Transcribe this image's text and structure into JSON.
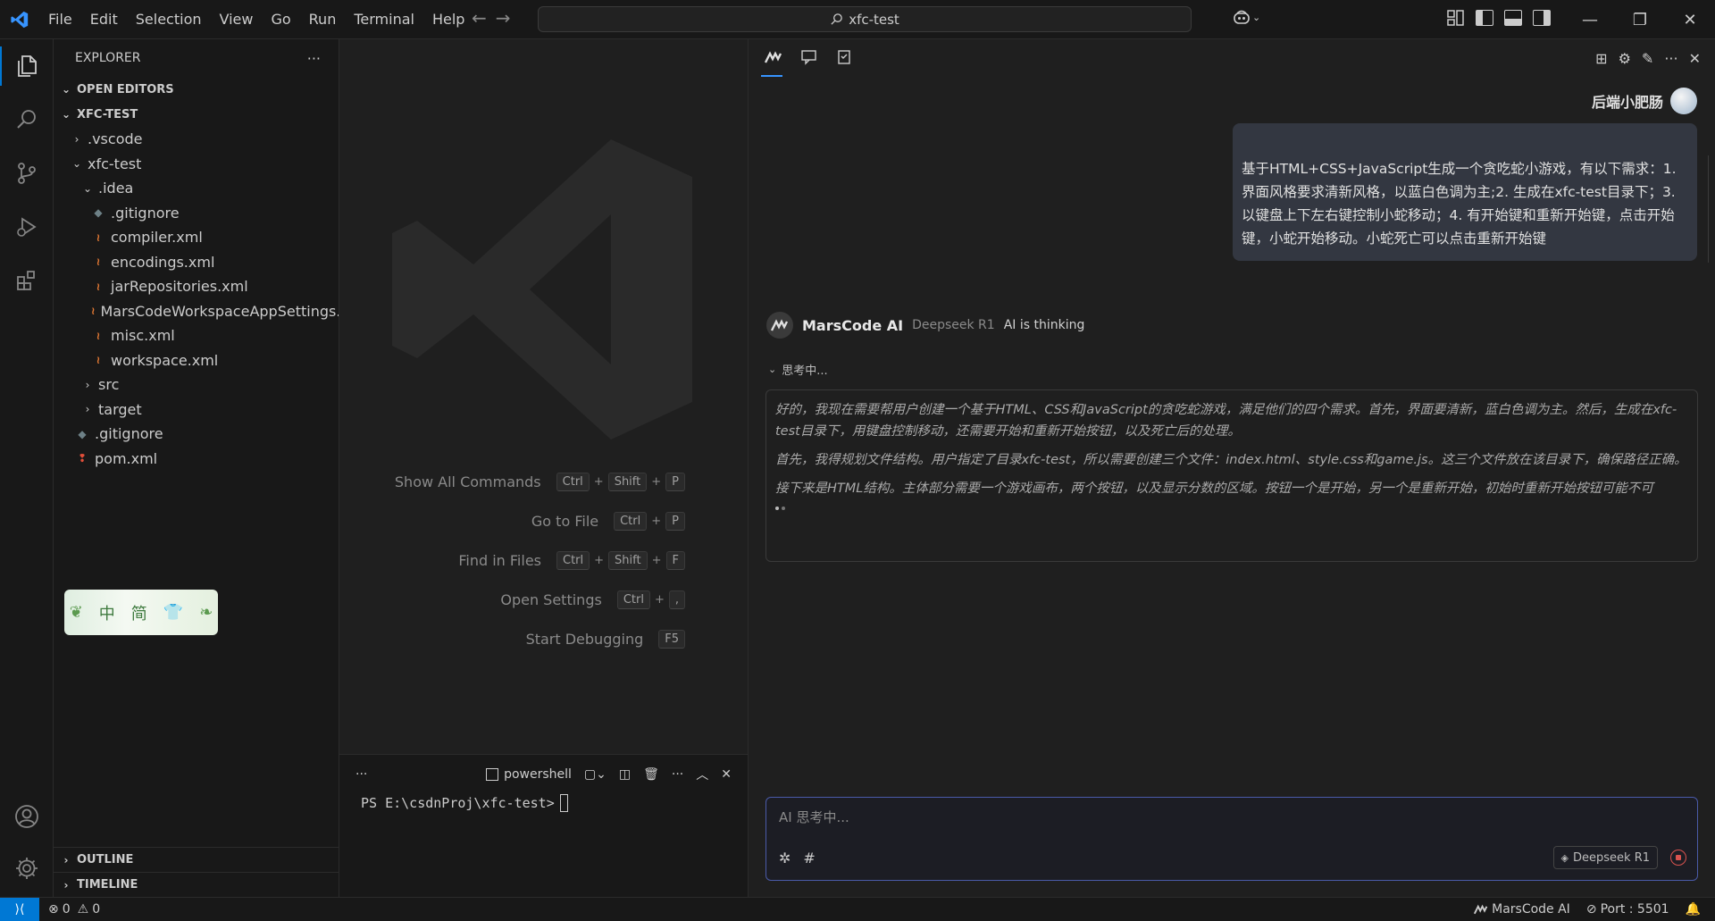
{
  "titlebar": {
    "menu": [
      "File",
      "Edit",
      "Selection",
      "View",
      "Go",
      "Run",
      "Terminal",
      "Help"
    ],
    "search": "xfc-test"
  },
  "sidebar": {
    "title": "EXPLORER",
    "more": "···",
    "open_editors": "OPEN EDITORS",
    "project": "XFC-TEST",
    "tree": [
      {
        "label": ".vscode",
        "indent": 1,
        "type": "folder",
        "open": false
      },
      {
        "label": "xfc-test",
        "indent": 1,
        "type": "folder",
        "open": true
      },
      {
        "label": ".idea",
        "indent": 2,
        "type": "folder",
        "open": true
      },
      {
        "label": ".gitignore",
        "indent": 3,
        "type": "git"
      },
      {
        "label": "compiler.xml",
        "indent": 3,
        "type": "xml"
      },
      {
        "label": "encodings.xml",
        "indent": 3,
        "type": "xml"
      },
      {
        "label": "jarRepositories.xml",
        "indent": 3,
        "type": "xml"
      },
      {
        "label": "MarsCodeWorkspaceAppSettings....",
        "indent": 3,
        "type": "xml"
      },
      {
        "label": "misc.xml",
        "indent": 3,
        "type": "xml"
      },
      {
        "label": "workspace.xml",
        "indent": 3,
        "type": "xml"
      },
      {
        "label": "src",
        "indent": 2,
        "type": "folder",
        "open": false
      },
      {
        "label": "target",
        "indent": 2,
        "type": "folder",
        "open": false
      },
      {
        "label": ".gitignore",
        "indent": 2,
        "type": "git"
      },
      {
        "label": "pom.xml",
        "indent": 2,
        "type": "maven"
      }
    ],
    "outline": "OUTLINE",
    "timeline": "TIMELINE",
    "lang_widget": {
      "a": "中",
      "b": "简"
    }
  },
  "editor": {
    "shortcuts": [
      {
        "label": "Show All Commands",
        "keys": [
          "Ctrl",
          "Shift",
          "P"
        ]
      },
      {
        "label": "Go to File",
        "keys": [
          "Ctrl",
          "P"
        ]
      },
      {
        "label": "Find in Files",
        "keys": [
          "Ctrl",
          "Shift",
          "F"
        ]
      },
      {
        "label": "Open Settings",
        "keys": [
          "Ctrl",
          ","
        ]
      },
      {
        "label": "Start Debugging",
        "keys": [
          "F5"
        ]
      }
    ]
  },
  "panel": {
    "more": "···",
    "shell": "powershell",
    "prompt": "PS E:\\csdnProj\\xfc-test>"
  },
  "chat": {
    "user_name": "后端小肥肠",
    "user_message": "基于HTML+CSS+JavaScript生成一个贪吃蛇小游戏，有以下需求：1.界面风格要求清新风格，以蓝白色调为主;2. 生成在xfc-test目录下；3.以键盘上下左右键控制小蛇移动；4. 有开始键和重新开始键，点击开始键，小蛇开始移动。小蛇死亡可以点击重新开始键",
    "ai_name": "MarsCode AI",
    "ai_model": "Deepseek R1",
    "ai_state": "AI is thinking",
    "thinking_label": "思考中...",
    "thinking": [
      "好的，我现在需要帮用户创建一个基于HTML、CSS和JavaScript的贪吃蛇游戏，满足他们的四个需求。首先，界面要清新，蓝白色调为主。然后，生成在xfc-test目录下，用键盘控制移动，还需要开始和重新开始按钮，以及死亡后的处理。",
      "首先，我得规划文件结构。用户指定了目录xfc-test，所以需要创建三个文件：index.html、style.css和game.js。这三个文件放在该目录下，确保路径正确。",
      "接下来是HTML结构。主体部分需要一个游戏画布，两个按钮，以及显示分数的区域。按钮一个是开始，另一个是重新开始，初始时重新开始按钮可能不可"
    ],
    "input_placeholder": "AI 思考中...",
    "model_pill": "Deepseek R1"
  },
  "statusbar": {
    "errors": "0",
    "warnings": "0",
    "marscode": "MarsCode AI",
    "port": "Port : 5501"
  },
  "colors": {
    "accent": "#0078d4",
    "xml": "#e37933",
    "maven": "#e04e39",
    "git": "#6d8086"
  }
}
